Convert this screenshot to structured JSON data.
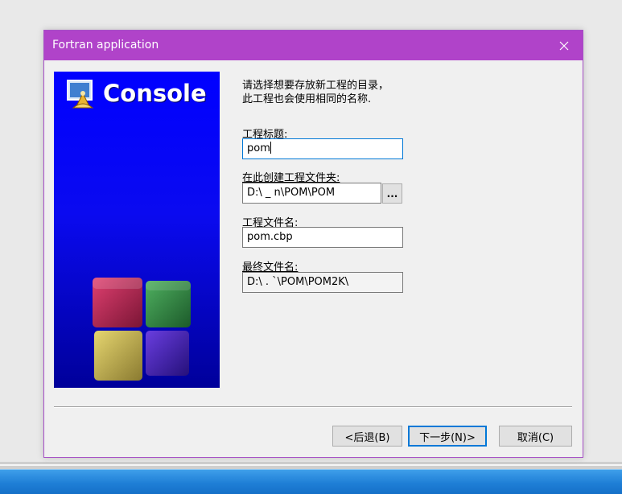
{
  "dialog": {
    "title": "Fortran application",
    "close_icon": "close-icon"
  },
  "banner": {
    "title": "Console",
    "logo_icon": "console-logo-icon"
  },
  "instructions": {
    "line1": "请选择想要存放新工程的目录，",
    "line2": "此工程也会使用相同的名称."
  },
  "fields": {
    "project_title": {
      "label": "工程标题:",
      "value": "pom"
    },
    "folder": {
      "label": "在此创建工程文件夹:",
      "value": "D:\\          _      n\\POM\\POM"
    },
    "project_file": {
      "label": "工程文件名:",
      "value": "pom.cbp"
    },
    "final_file": {
      "label": "最终文件名:",
      "value": "D:\\           .     `\\POM\\POM2K\\"
    }
  },
  "browse_button": {
    "label": "..."
  },
  "buttons": {
    "back": "<后退(B)",
    "next": "下一步(N)>",
    "cancel": "取消(C)"
  },
  "colors": {
    "title_bar": "#b043c9",
    "banner": "#0000ff",
    "focus": "#0078d7"
  }
}
